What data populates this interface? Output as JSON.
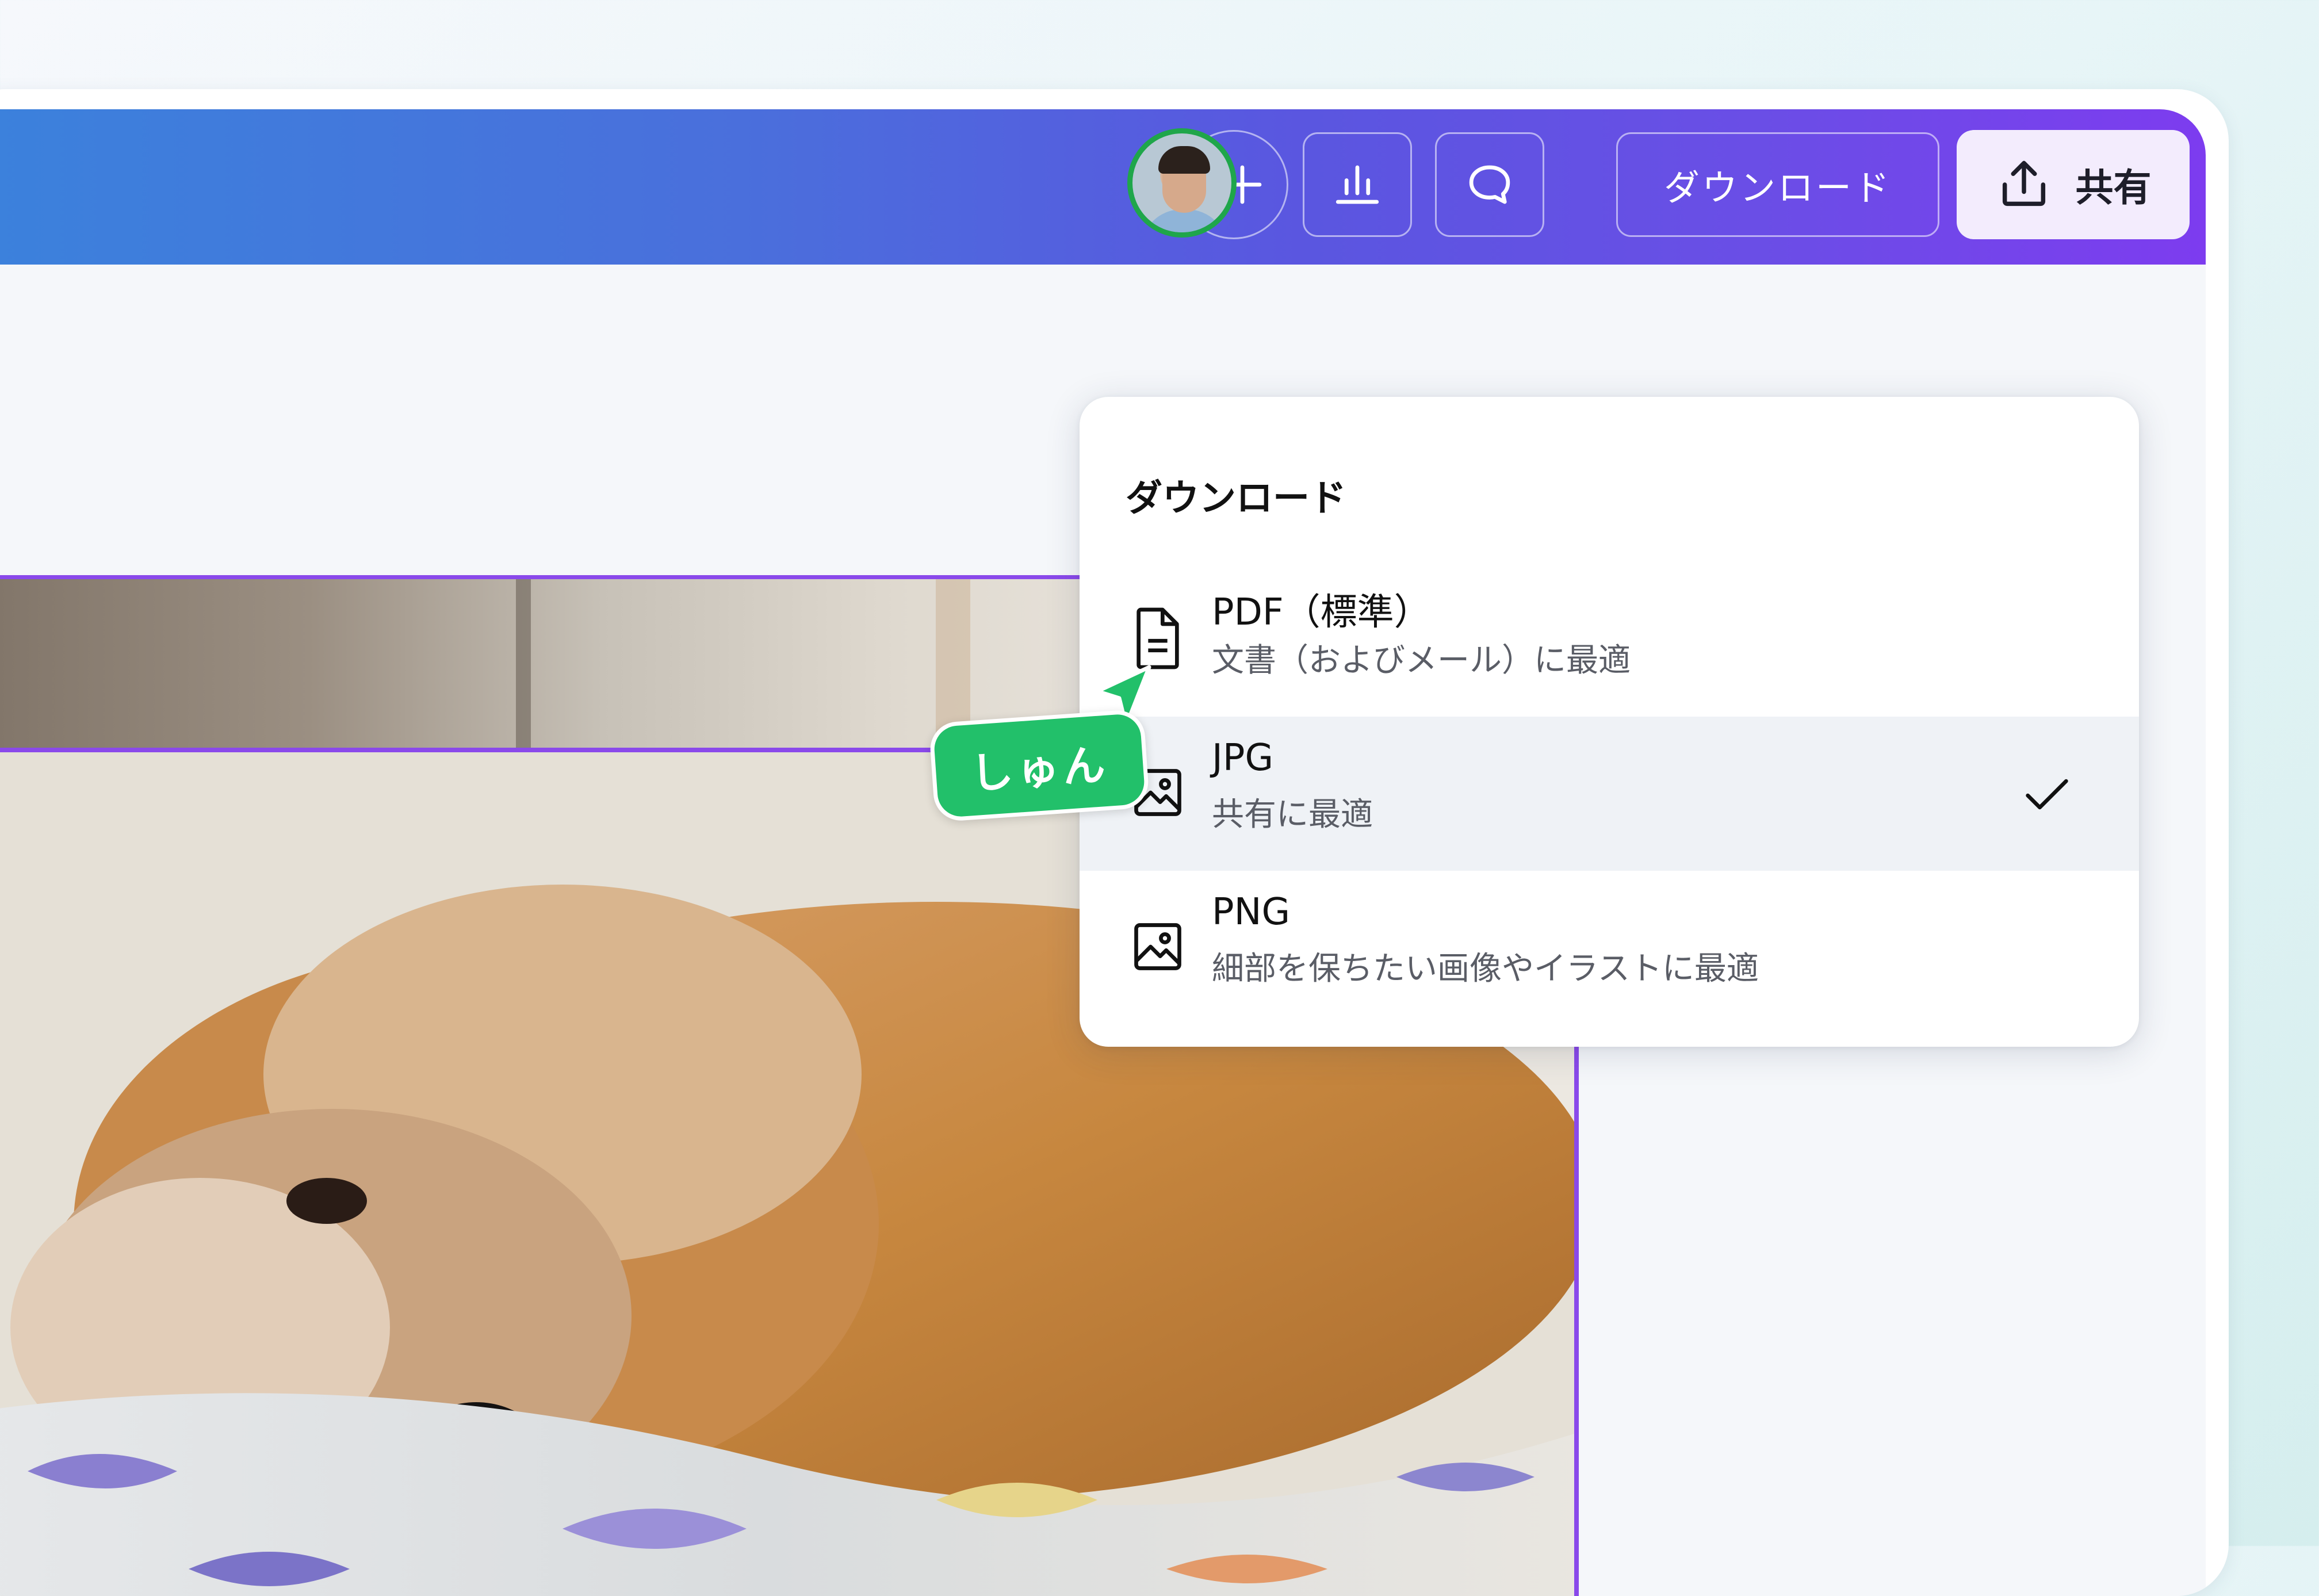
{
  "header": {
    "download_label": "ダウンロード",
    "share_label": "共有"
  },
  "collaborator": {
    "cursor_name": "しゅん",
    "cursor_color": "#22c06a"
  },
  "download_menu": {
    "title": "ダウンロード",
    "items": [
      {
        "name": "PDF（標準）",
        "description": "文書（およびメール）に最適",
        "icon": "document-icon",
        "selected": false
      },
      {
        "name": "JPG",
        "description": "共有に最適",
        "icon": "image-icon",
        "selected": true
      },
      {
        "name": "PNG",
        "description": "細部を保ちたい画像やイラストに最適",
        "icon": "image-icon",
        "selected": false
      }
    ]
  },
  "colors": {
    "accent": "#8a49ea",
    "header_gradient_start": "#3b82dc",
    "header_gradient_end": "#7d3cef"
  }
}
